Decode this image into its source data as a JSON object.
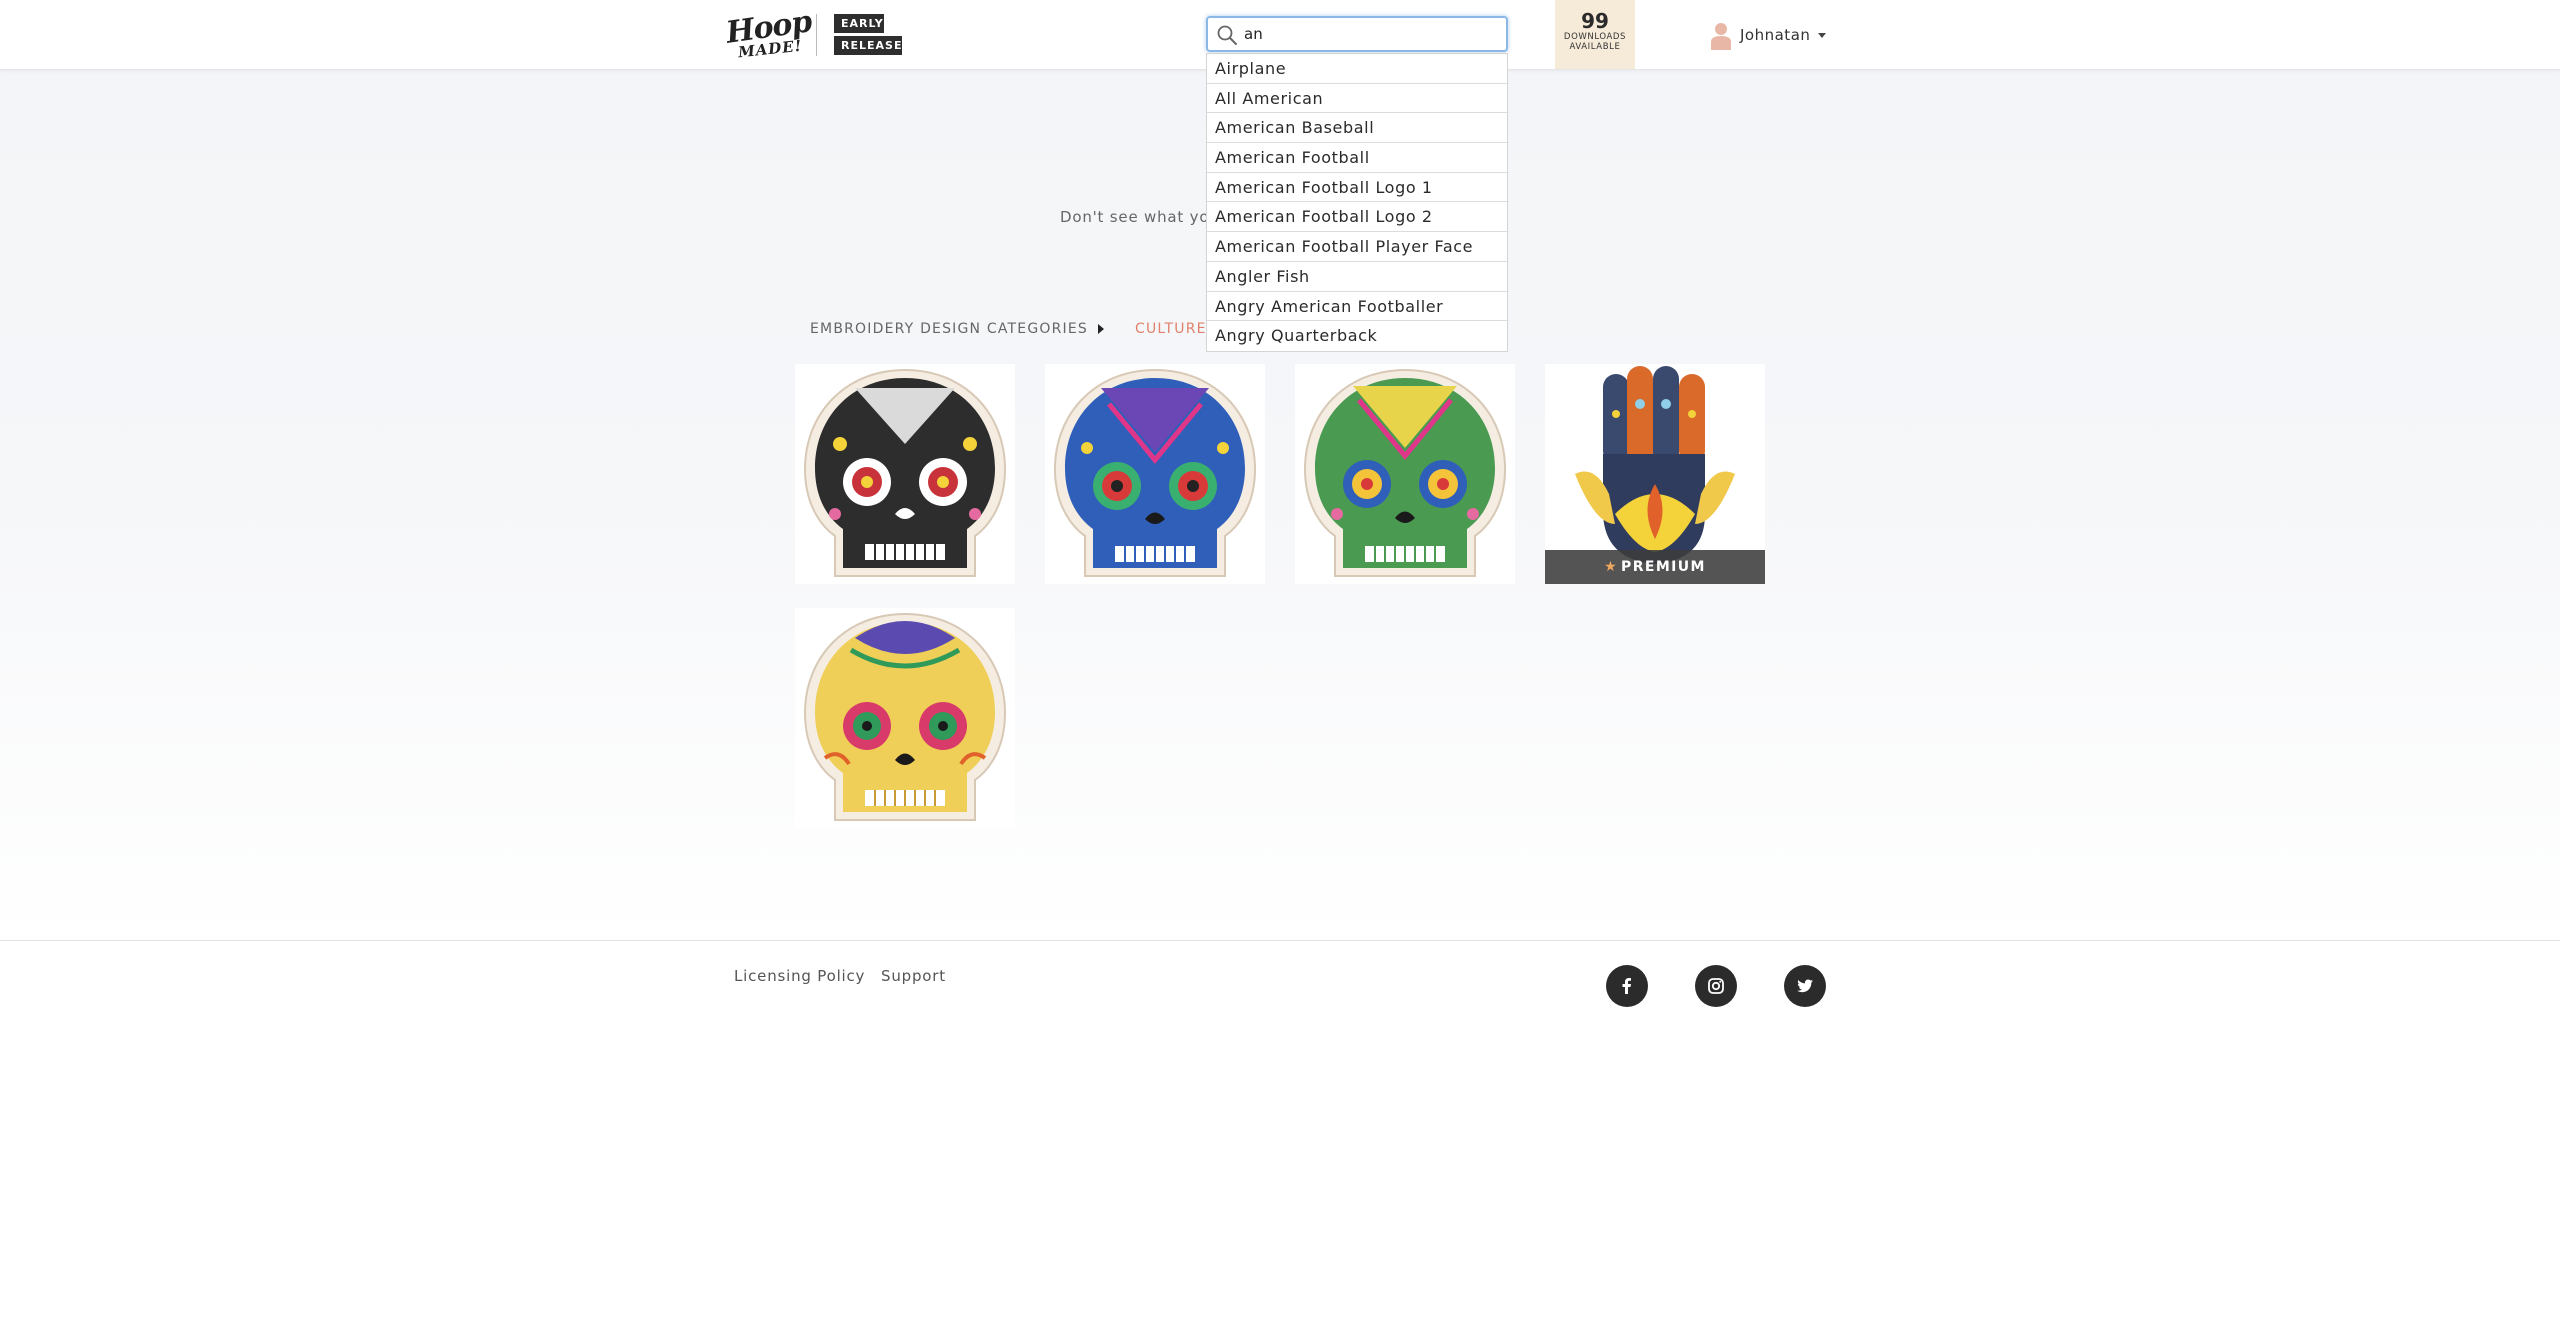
{
  "header": {
    "logo_top": "Hoop",
    "logo_bottom": "MADE!",
    "badge_1": "EARLY",
    "badge_2": "RELEASE",
    "search": {
      "value": "an",
      "placeholder": ""
    },
    "suggestions": [
      "Airplane",
      "All American",
      "American Baseball",
      "American Football",
      "American Football Logo 1",
      "American Football Logo 2",
      "American Football Player Face",
      "Angler Fish",
      "Angry American Footballer",
      "Angry Quarterback"
    ],
    "downloads": {
      "count": "99",
      "label_1": "DOWNLOADS",
      "label_2": "AVAILABLE"
    },
    "user": {
      "name": "Johnatan"
    }
  },
  "main": {
    "notice": "Don't see what you'",
    "breadcrumb": [
      "EMBROIDERY DESIGN CATEGORIES",
      "CULTURE"
    ],
    "tiles": [
      {
        "name": "white-sugar-skull",
        "premium": false
      },
      {
        "name": "blue-sugar-skull",
        "premium": false
      },
      {
        "name": "green-sugar-skull",
        "premium": false
      },
      {
        "name": "hamsa-hand",
        "premium": true,
        "badge": "PREMIUM"
      },
      {
        "name": "yellow-sugar-skull",
        "premium": false
      }
    ]
  },
  "footer": {
    "links": [
      "Licensing Policy",
      "Support"
    ],
    "social": [
      "facebook-icon",
      "instagram-icon",
      "twitter-icon"
    ]
  },
  "colors": {
    "accent": "#e0826b",
    "focus_border": "#8cb8e6",
    "downloads_bg": "#f6ead8",
    "dark": "#2b2b2b"
  }
}
